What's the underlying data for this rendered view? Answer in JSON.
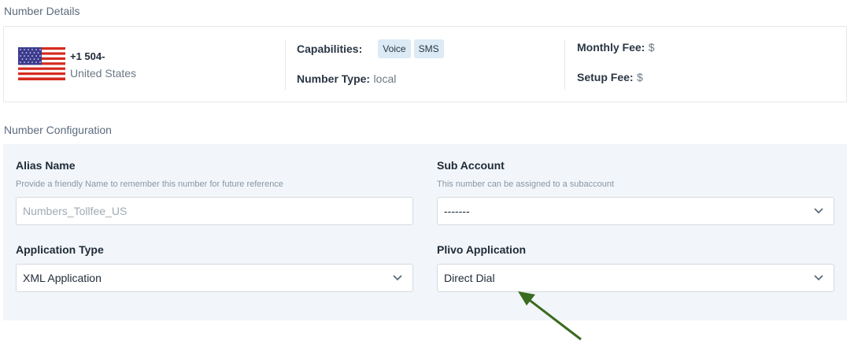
{
  "number_details": {
    "title": "Number Details",
    "phone": "+1 504-",
    "country": "United States",
    "capabilities_label": "Capabilities:",
    "capabilities": [
      "Voice",
      "SMS"
    ],
    "number_type_label": "Number Type:",
    "number_type": "local",
    "monthly_fee_label": "Monthly Fee:",
    "monthly_fee": "$",
    "setup_fee_label": "Setup Fee:",
    "setup_fee": "$"
  },
  "number_configuration": {
    "title": "Number Configuration",
    "alias": {
      "label": "Alias Name",
      "help": "Provide a friendly Name to remember this number for future reference",
      "placeholder": "Numbers_Tollfee_US"
    },
    "sub_account": {
      "label": "Sub Account",
      "help": "This number can be assigned to a subaccount",
      "value": "-------"
    },
    "application_type": {
      "label": "Application Type",
      "value": "XML Application"
    },
    "plivo_application": {
      "label": "Plivo Application",
      "value": "Direct Dial"
    }
  },
  "colors": {
    "badge_bg": "#dbeaf5",
    "panel_bg": "#f2f6fa",
    "arrow": "#3a6b1f"
  },
  "icons": [
    "us-flag-icon",
    "chevron-down-icon",
    "annotation-arrow"
  ]
}
